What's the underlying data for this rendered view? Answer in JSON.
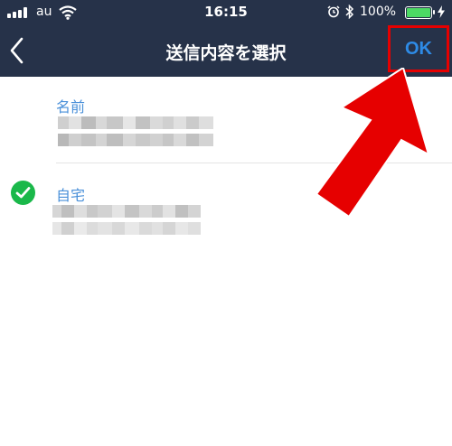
{
  "status_bar": {
    "carrier": "au",
    "time": "16:15",
    "battery_percent": "100%",
    "icons": [
      "signal-icon",
      "wifi-icon",
      "alarm-icon",
      "bluetooth-icon",
      "battery-icon",
      "charging-icon"
    ]
  },
  "nav": {
    "title": "送信内容を選択",
    "ok_label": "OK",
    "back_icon": "chevron-left-icon"
  },
  "list": {
    "items": [
      {
        "label": "名前",
        "value_redacted": true,
        "selected": false
      },
      {
        "label": "自宅",
        "value_redacted": true,
        "selected": true
      }
    ]
  },
  "colors": {
    "header_bg": "#263249",
    "label_blue": "#4a90d9",
    "ok_blue": "#2e8be6",
    "check_green": "#1ab84a",
    "annotation_red": "#e60000",
    "battery_green": "#4cd964"
  }
}
